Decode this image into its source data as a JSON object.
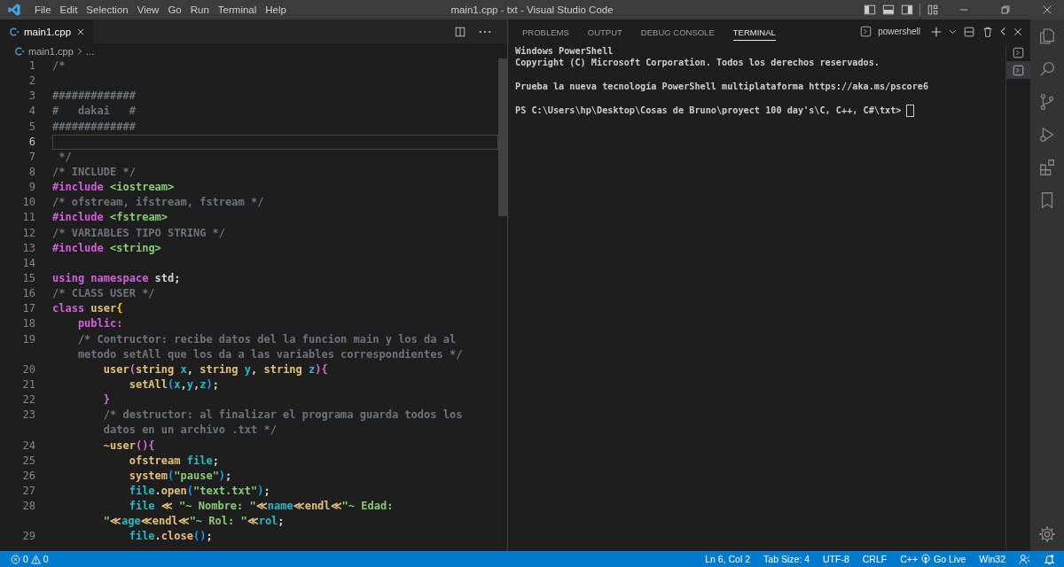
{
  "window": {
    "title": "main1.cpp - txt - Visual Studio Code"
  },
  "menu": [
    "File",
    "Edit",
    "Selection",
    "View",
    "Go",
    "Run",
    "Terminal",
    "Help"
  ],
  "editor": {
    "tabs": [
      {
        "label": "main1.cpp",
        "selected": true
      }
    ],
    "breadcrumb": {
      "file": "main1.cpp",
      "rest": "..."
    },
    "rows": [
      {
        "number": "1",
        "selected": false,
        "tokens": [
          {
            "kind": "comment",
            "text": "/*"
          }
        ]
      },
      {
        "number": "2",
        "selected": false
      },
      {
        "number": "3",
        "selected": false,
        "tokens": [
          {
            "kind": "comment",
            "text": "#############"
          }
        ]
      },
      {
        "number": "4",
        "selected": false,
        "tokens": [
          {
            "kind": "comment",
            "text": "#   dakai   #"
          }
        ]
      },
      {
        "number": "5",
        "selected": false,
        "tokens": [
          {
            "kind": "comment",
            "text": "#############"
          }
        ]
      },
      {
        "number": "6",
        "selected": true
      },
      {
        "number": "7",
        "selected": false,
        "tokens": [
          {
            "kind": "comment",
            "text": " */"
          }
        ]
      },
      {
        "number": "8",
        "selected": false,
        "tokens": [
          {
            "kind": "comment",
            "text": "/* INCLUDE */"
          }
        ]
      },
      {
        "number": "9",
        "selected": false,
        "tokens": [
          {
            "kind": "keyword",
            "text": "#include "
          },
          {
            "kind": "string",
            "text": "<iostream>"
          }
        ]
      },
      {
        "number": "10",
        "selected": false,
        "tokens": [
          {
            "kind": "comment",
            "text": "/* ofstream, ifstream, fstream */"
          }
        ]
      },
      {
        "number": "11",
        "selected": false,
        "tokens": [
          {
            "kind": "keyword",
            "text": "#include "
          },
          {
            "kind": "string",
            "text": "<fstream>"
          }
        ]
      },
      {
        "number": "12",
        "selected": false,
        "tokens": [
          {
            "kind": "comment",
            "text": "/* VARIABLES TIPO STRING */"
          }
        ]
      },
      {
        "number": "13",
        "selected": false,
        "tokens": [
          {
            "kind": "keyword",
            "text": "#include "
          },
          {
            "kind": "string",
            "text": "<string>"
          }
        ]
      },
      {
        "number": "14",
        "selected": false
      },
      {
        "number": "15",
        "selected": false,
        "tokens": [
          {
            "kind": "keyword",
            "text": "using namespace"
          },
          {
            "kind": "plain",
            "text": " std;"
          }
        ]
      },
      {
        "number": "16",
        "selected": false,
        "tokens": [
          {
            "kind": "comment",
            "text": "/* CLASS USER */"
          }
        ]
      },
      {
        "number": "17",
        "selected": false,
        "tokens": [
          {
            "kind": "keyword",
            "text": "class "
          },
          {
            "kind": "type",
            "text": "user"
          },
          {
            "kind": "bracket1",
            "text": "{"
          }
        ]
      },
      {
        "number": "18",
        "selected": false,
        "tokens": [
          {
            "kind": "keyword",
            "text": "    public:"
          }
        ]
      },
      {
        "number": "19",
        "selected": false,
        "tokens": [
          {
            "kind": "comment",
            "text": "    /* Contructor: recibe datos del la funcion main y los da al"
          }
        ]
      },
      {
        "selected": false,
        "tokens": [
          {
            "kind": "comment",
            "text": "    metodo setAll que los da a las variables correspondientes */"
          }
        ]
      },
      {
        "number": "20",
        "selected": false,
        "tokens": [
          {
            "kind": "func",
            "text": "        user"
          },
          {
            "kind": "bracket2",
            "text": "("
          },
          {
            "kind": "type",
            "text": "string "
          },
          {
            "kind": "var",
            "text": "x"
          },
          {
            "kind": "plain",
            "text": ", "
          },
          {
            "kind": "type",
            "text": "string "
          },
          {
            "kind": "var",
            "text": "y"
          },
          {
            "kind": "plain",
            "text": ", "
          },
          {
            "kind": "type",
            "text": "string "
          },
          {
            "kind": "var",
            "text": "z"
          },
          {
            "kind": "bracket2",
            "text": "){"
          }
        ]
      },
      {
        "number": "21",
        "selected": false,
        "tokens": [
          {
            "kind": "func",
            "text": "            setAll"
          },
          {
            "kind": "bracket3",
            "text": "("
          },
          {
            "kind": "var",
            "text": "x"
          },
          {
            "kind": "plain",
            "text": ","
          },
          {
            "kind": "var",
            "text": "y"
          },
          {
            "kind": "plain",
            "text": ","
          },
          {
            "kind": "var",
            "text": "z"
          },
          {
            "kind": "bracket3",
            "text": ")"
          },
          {
            "kind": "plain",
            "text": ";"
          }
        ]
      },
      {
        "number": "22",
        "selected": false,
        "tokens": [
          {
            "kind": "bracket2",
            "text": "        }"
          }
        ]
      },
      {
        "number": "23",
        "selected": false,
        "tokens": [
          {
            "kind": "comment",
            "text": "        /* destructor: al finalizar el programa guarda todos los"
          }
        ]
      },
      {
        "selected": false,
        "tokens": [
          {
            "kind": "comment",
            "text": "        datos en un archivo .txt */"
          }
        ]
      },
      {
        "number": "24",
        "selected": false,
        "tokens": [
          {
            "kind": "func",
            "text": "        ~user"
          },
          {
            "kind": "bracket2",
            "text": "(){"
          }
        ]
      },
      {
        "number": "25",
        "selected": false,
        "tokens": [
          {
            "kind": "type",
            "text": "            ofstream "
          },
          {
            "kind": "var",
            "text": "file"
          },
          {
            "kind": "plain",
            "text": ";"
          }
        ]
      },
      {
        "number": "26",
        "selected": false,
        "tokens": [
          {
            "kind": "func",
            "text": "            system"
          },
          {
            "kind": "bracket3",
            "text": "("
          },
          {
            "kind": "string",
            "text": "\"pause\""
          },
          {
            "kind": "bracket3",
            "text": ")"
          },
          {
            "kind": "plain",
            "text": ";"
          }
        ]
      },
      {
        "number": "27",
        "selected": false,
        "tokens": [
          {
            "kind": "var",
            "text": "            file"
          },
          {
            "kind": "plain",
            "text": "."
          },
          {
            "kind": "func",
            "text": "open"
          },
          {
            "kind": "bracket3",
            "text": "("
          },
          {
            "kind": "string",
            "text": "\"text.txt\""
          },
          {
            "kind": "bracket3",
            "text": ")"
          },
          {
            "kind": "plain",
            "text": ";"
          }
        ]
      },
      {
        "number": "28",
        "selected": false,
        "tokens": [
          {
            "kind": "var",
            "text": "            file "
          },
          {
            "kind": "func",
            "text": "≪ "
          },
          {
            "kind": "string",
            "text": "\"~ Nombre: \""
          },
          {
            "kind": "func",
            "text": "≪"
          },
          {
            "kind": "var",
            "text": "name"
          },
          {
            "kind": "func",
            "text": "≪endl≪"
          },
          {
            "kind": "string",
            "text": "\"~ Edad:"
          }
        ]
      },
      {
        "selected": false,
        "tokens": [
          {
            "kind": "string",
            "text": "        \""
          },
          {
            "kind": "func",
            "text": "≪"
          },
          {
            "kind": "var",
            "text": "age"
          },
          {
            "kind": "func",
            "text": "≪endl≪"
          },
          {
            "kind": "string",
            "text": "\"~ Rol: \""
          },
          {
            "kind": "func",
            "text": "≪"
          },
          {
            "kind": "var",
            "text": "rol"
          },
          {
            "kind": "plain",
            "text": ";"
          }
        ]
      },
      {
        "number": "29",
        "selected": false,
        "tokens": [
          {
            "kind": "var",
            "text": "            file"
          },
          {
            "kind": "plain",
            "text": "."
          },
          {
            "kind": "func",
            "text": "close"
          },
          {
            "kind": "bracket3",
            "text": "()"
          },
          {
            "kind": "plain",
            "text": ";"
          }
        ]
      }
    ]
  },
  "panel": {
    "tabs": [
      {
        "label": "PROBLEMS",
        "selected": false
      },
      {
        "label": "OUTPUT",
        "selected": false
      },
      {
        "label": "DEBUG CONSOLE",
        "selected": false
      },
      {
        "label": "TERMINAL",
        "selected": true
      }
    ],
    "terminal_name": "powershell",
    "terminal_paragraphs": [
      [
        "Windows PowerShell",
        "Copyright (C) Microsoft Corporation. Todos los derechos reservados."
      ],
      [
        "Prueba la nueva tecnología PowerShell multiplataforma https://aka.ms/pscore6"
      ],
      [
        "PS C:\\Users\\hp\\Desktop\\Cosas de Bruno\\proyect 100 day's\\C, C++, C#\\txt>"
      ]
    ],
    "terminal_instances": [
      {
        "selected": false
      },
      {
        "selected": true
      }
    ]
  },
  "status_bar": {
    "errors": "0",
    "warnings": "0",
    "items": [
      "Ln 6, Col 2",
      "Tab Size: 4",
      "UTF-8",
      "CRLF",
      "C++"
    ],
    "go_live": "Go Live",
    "platform": "Win32"
  }
}
